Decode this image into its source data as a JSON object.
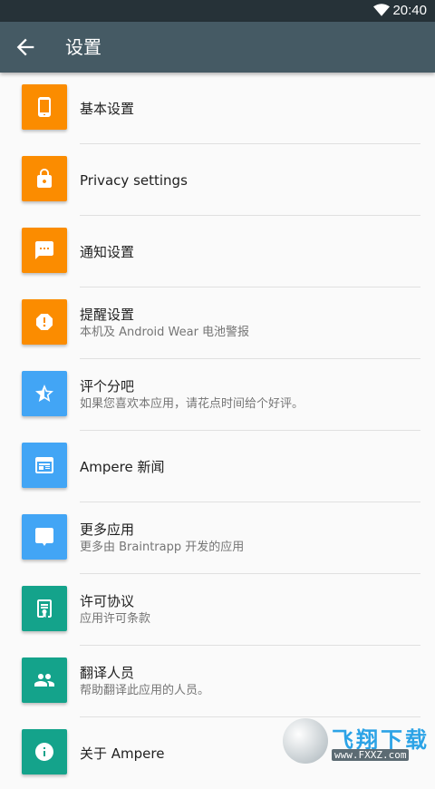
{
  "status_bar": {
    "time": "20:40",
    "wifi_icon": "wifi-icon"
  },
  "app_bar": {
    "title": "设置",
    "back_icon": "arrow-back-icon"
  },
  "colors": {
    "orange": "#fb8c00",
    "blue": "#42a5f5",
    "teal": "#14a38b",
    "app_bar": "#455a64",
    "status_bar": "#263238"
  },
  "items": [
    {
      "label": "基本设置",
      "subtitle": "",
      "icon": "phone-icon"
    },
    {
      "label": "Privacy settings",
      "subtitle": "",
      "icon": "lock-icon"
    },
    {
      "label": "通知设置",
      "subtitle": "",
      "icon": "message-icon"
    },
    {
      "label": "提醒设置",
      "subtitle": "本机及 Android Wear 电池警报",
      "icon": "alert-icon"
    },
    {
      "label": "评个分吧",
      "subtitle": "如果您喜欢本应用，请花点时间给个好评。",
      "icon": "star-half-icon"
    },
    {
      "label": "Ampere 新闻",
      "subtitle": "",
      "icon": "news-icon"
    },
    {
      "label": "更多应用",
      "subtitle": "更多由 Braintrapp 开发的应用",
      "icon": "chat-bubble-icon"
    },
    {
      "label": "许可协议",
      "subtitle": "应用许可条款",
      "icon": "license-icon"
    },
    {
      "label": "翻译人员",
      "subtitle": "帮助翻译此应用的人员。",
      "icon": "people-icon"
    },
    {
      "label": "关于 Ampere",
      "subtitle": "",
      "icon": "info-icon"
    }
  ],
  "watermark": {
    "brand": "飞翔下载",
    "url": "www.FXXZ.com"
  }
}
